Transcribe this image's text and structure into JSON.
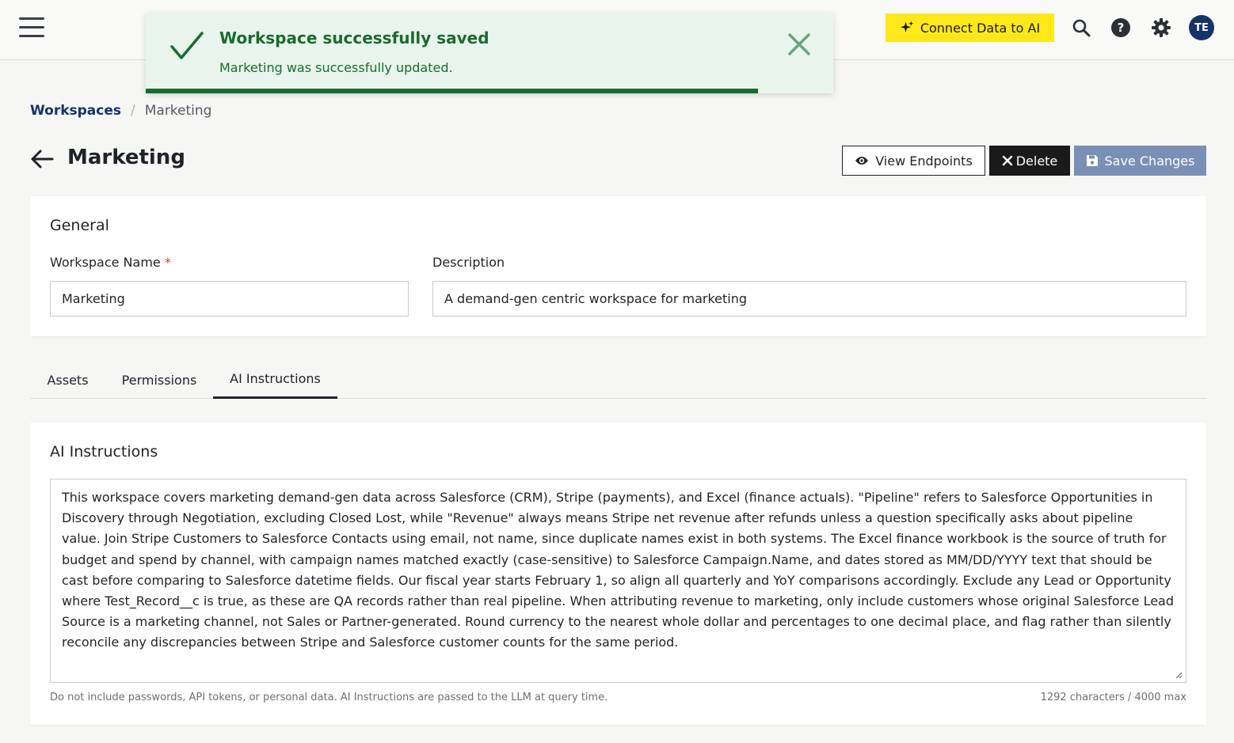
{
  "topbar": {
    "connect_label": "Connect Data to AI",
    "avatar_initials": "TE"
  },
  "toast": {
    "title": "Workspace successfully saved",
    "message": "Marketing was successfully updated.",
    "progress": 0.89
  },
  "breadcrumb": {
    "root": "Workspaces",
    "separator": "/",
    "current": "Marketing"
  },
  "page": {
    "title": "Marketing",
    "view_endpoints_label": "View Endpoints",
    "delete_label": "Delete",
    "save_label": "Save Changes"
  },
  "general": {
    "section_title": "General",
    "name_label": "Workspace Name",
    "required_mark": "*",
    "name_value": "Marketing",
    "description_label": "Description",
    "description_value": "A demand-gen centric workspace for marketing"
  },
  "tabs": [
    {
      "label": "Assets",
      "active": false
    },
    {
      "label": "Permissions",
      "active": false
    },
    {
      "label": "AI Instructions",
      "active": true
    }
  ],
  "ai": {
    "section_title": "AI Instructions",
    "instructions": "This workspace covers marketing demand-gen data across Salesforce (CRM), Stripe (payments), and Excel (finance actuals). \"Pipeline\" refers to Salesforce Opportunities in Discovery through Negotiation, excluding Closed Lost, while \"Revenue\" always means Stripe net revenue after refunds unless a question specifically asks about pipeline value. Join Stripe Customers to Salesforce Contacts using email, not name, since duplicate names exist in both systems. The Excel finance workbook is the source of truth for budget and spend by channel, with campaign names matched exactly (case-sensitive) to Salesforce Campaign.Name, and dates stored as MM/DD/YYYY text that should be cast before comparing to Salesforce datetime fields. Our fiscal year starts February 1, so align all quarterly and YoY comparisons accordingly. Exclude any Lead or Opportunity where Test_Record__c is true, as these are QA records rather than real pipeline. When attributing revenue to marketing, only include customers whose original Salesforce Lead Source is a marketing channel, not Sales or Partner-generated. Round currency to the nearest whole dollar and percentages to one decimal place, and flag rather than silently reconcile any discrepancies between Stripe and Salesforce customer counts for the same period.",
    "hint": "Do not include passwords, API tokens, or personal data. AI Instructions are passed to the LLM at query time.",
    "char_count": "1292 characters / 4000 max"
  }
}
